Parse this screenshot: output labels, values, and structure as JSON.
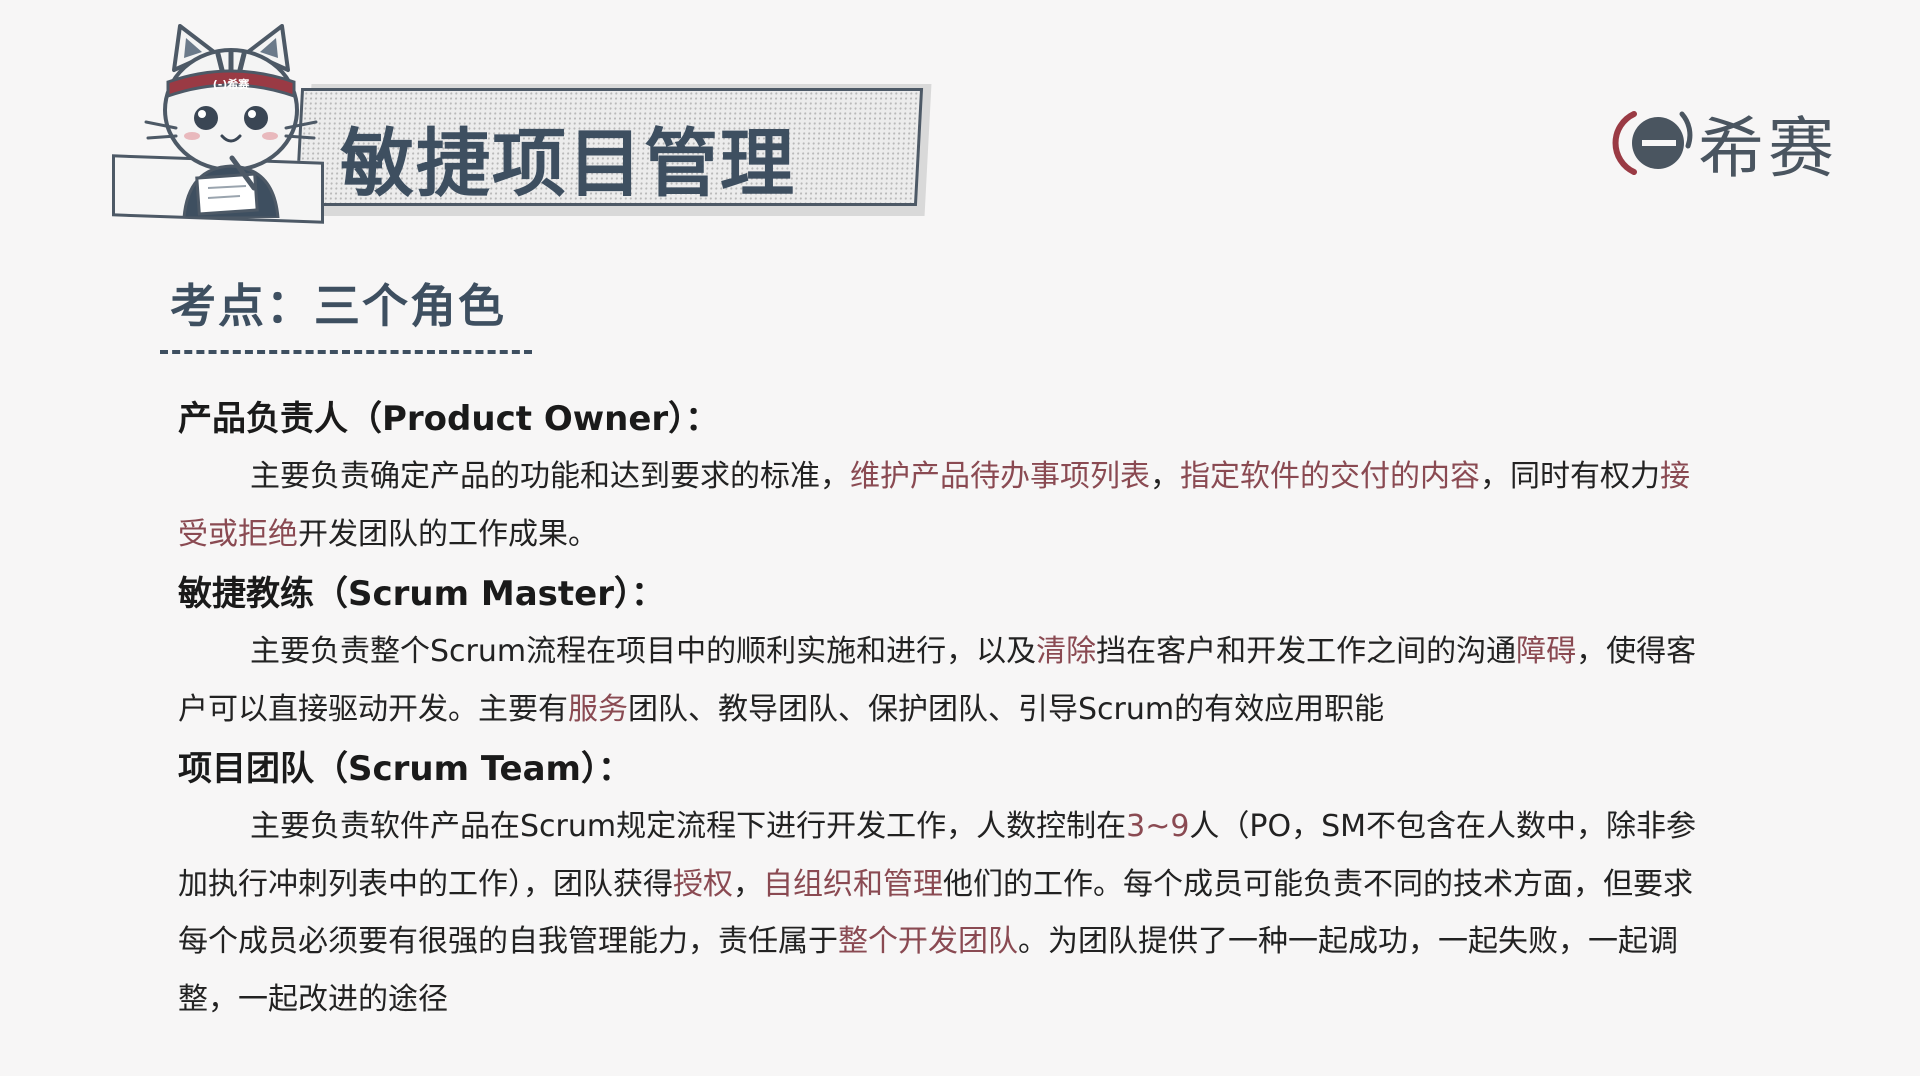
{
  "header": {
    "title": "敏捷项目管理",
    "mascot_headband_text": "(-)希赛"
  },
  "logo": {
    "text": "希赛",
    "icon": "xisai-logo-icon"
  },
  "section": {
    "title": "考点：三个角色"
  },
  "colors": {
    "accent_dark": "#3e4f60",
    "highlight": "#8a4a52",
    "background": "#f7f6f6"
  },
  "roles": [
    {
      "title": "产品负责人（Product Owner）：",
      "segments": [
        {
          "text": "主要负责确定产品的功能和达到要求的标准，",
          "hl": false
        },
        {
          "text": "维护产品待办事项列表",
          "hl": true
        },
        {
          "text": "，",
          "hl": false
        },
        {
          "text": "指定软件的交付的内容",
          "hl": true
        },
        {
          "text": "，同时有权力",
          "hl": false
        },
        {
          "text": "接受或拒绝",
          "hl": true
        },
        {
          "text": "开发团队的工作成果。",
          "hl": false
        }
      ]
    },
    {
      "title": "敏捷教练（Scrum Master）：",
      "segments": [
        {
          "text": "主要负责整个Scrum流程在项目中的顺利实施和进行，以及",
          "hl": false
        },
        {
          "text": "清除",
          "hl": true
        },
        {
          "text": "挡在客户和开发工作之间的沟通",
          "hl": false
        },
        {
          "text": "障碍",
          "hl": true
        },
        {
          "text": "，使得客户可以直接驱动开发。主要有",
          "hl": false
        },
        {
          "text": "服务",
          "hl": true
        },
        {
          "text": "团队、教导团队、保护团队、引导Scrum的有效应用职能",
          "hl": false
        }
      ]
    },
    {
      "title": "项目团队（Scrum Team）：",
      "segments": [
        {
          "text": "主要负责软件产品在Scrum规定流程下进行开发工作，人数控制在",
          "hl": false
        },
        {
          "text": "3~9",
          "hl": true
        },
        {
          "text": "人（PO，SM不包含在人数中，除非参加执行冲刺列表中的工作），团队获得",
          "hl": false
        },
        {
          "text": "授权",
          "hl": true
        },
        {
          "text": "，",
          "hl": false
        },
        {
          "text": "自组织和管理",
          "hl": true
        },
        {
          "text": "他们的工作。每个成员可能负责不同的技术方面，但要求每个成员必须要有很强的自我管理能力，责任属于",
          "hl": false
        },
        {
          "text": "整个开发团队",
          "hl": true
        },
        {
          "text": "。为团队提供了一种一起成功，一起失败，一起调整，一起改进的途径",
          "hl": false
        }
      ]
    }
  ]
}
